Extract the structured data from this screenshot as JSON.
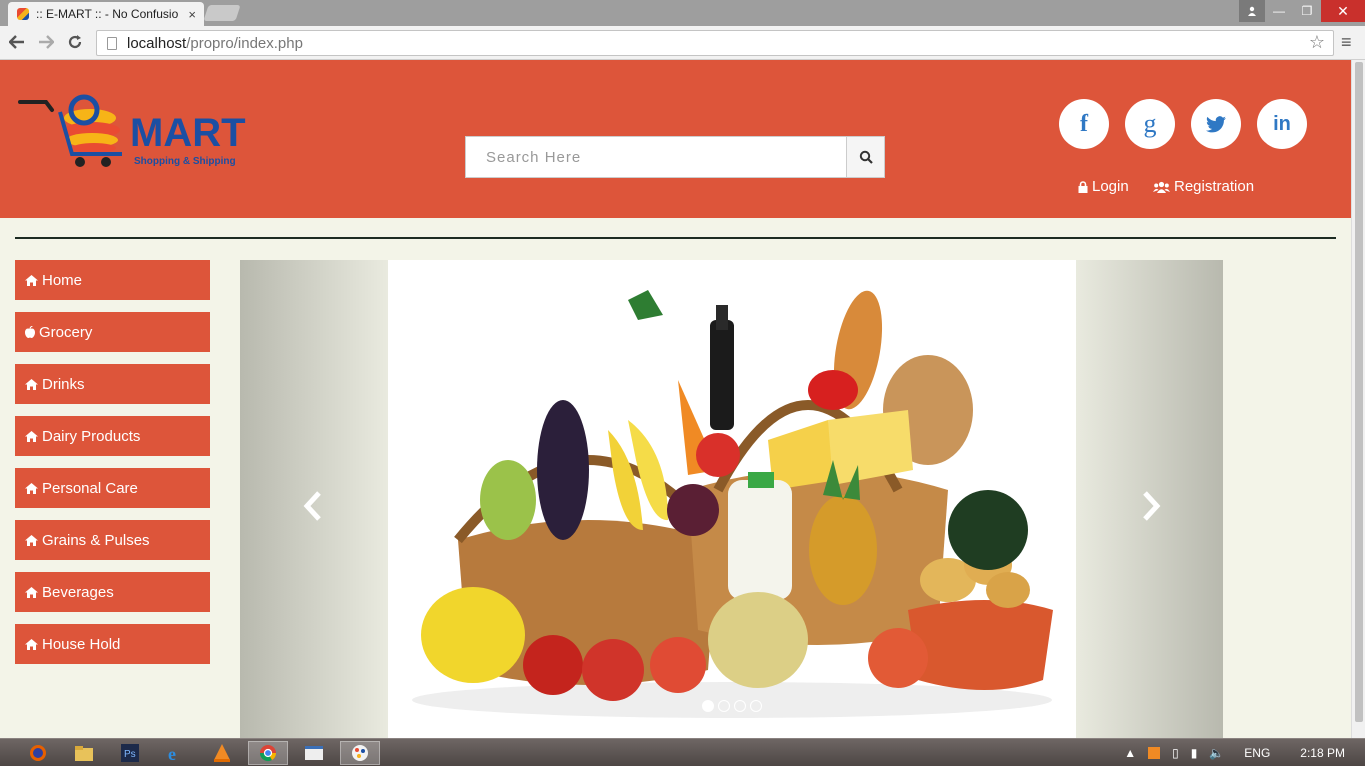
{
  "browser": {
    "tab_title": ":: E-MART :: - No Confusio",
    "tab_close": "×",
    "url_host": "localhost",
    "url_path": "/propro/index.php",
    "min": "—",
    "restore": "❐",
    "close": "✕"
  },
  "header": {
    "logo_mark": "MART",
    "logo_tagline": "Shopping & Shipping",
    "search_placeholder": "Search Here",
    "social": {
      "facebook": "f",
      "google": "g",
      "twitter": "twitter",
      "linkedin": "in"
    },
    "login_label": "Login",
    "registration_label": "Registration"
  },
  "sidebar": {
    "items": [
      {
        "label": "Home",
        "icon": "home-icon"
      },
      {
        "label": "Grocery",
        "icon": "apple-icon"
      },
      {
        "label": "Drinks",
        "icon": "home-icon"
      },
      {
        "label": "Dairy Products",
        "icon": "home-icon"
      },
      {
        "label": "Personal Care",
        "icon": "home-icon"
      },
      {
        "label": "Grains & Pulses",
        "icon": "home-icon"
      },
      {
        "label": "Beverages",
        "icon": "home-icon"
      },
      {
        "label": "House Hold",
        "icon": "home-icon"
      }
    ]
  },
  "carousel": {
    "slide_count": 4,
    "active_index": 0
  },
  "taskbar": {
    "language": "ENG",
    "time": "2:18 PM"
  },
  "colors": {
    "brand": "#dd553a",
    "page_bg": "#f3f4e8",
    "social_icon": "#2f78c4"
  }
}
